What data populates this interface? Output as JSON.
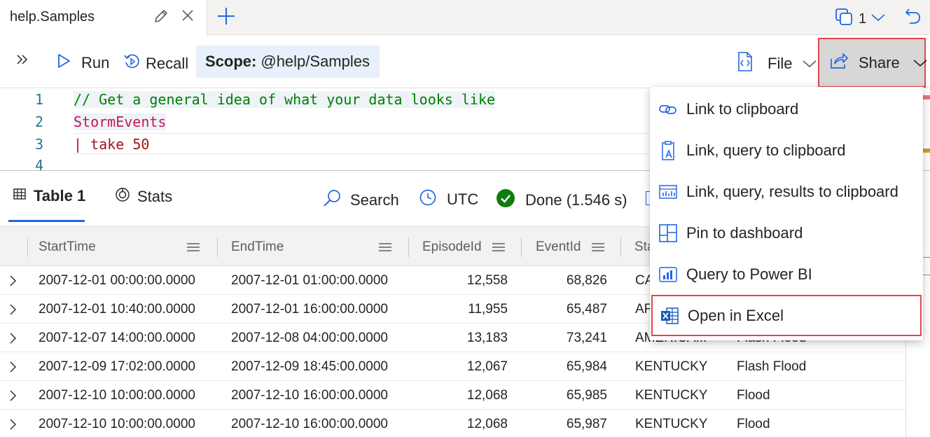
{
  "tab": {
    "title": "help.Samples",
    "copies_count": "1"
  },
  "toolbar": {
    "run_label": "Run",
    "recall_label": "Recall",
    "scope_key": "Scope:",
    "scope_value": "@help/Samples",
    "file_label": "File",
    "share_label": "Share"
  },
  "editor": {
    "lines": [
      {
        "number": "1",
        "text": "// Get a general idea of what your data looks like"
      },
      {
        "number": "2",
        "text": "StormEvents"
      },
      {
        "number": "3",
        "pipe": "| ",
        "keyword": "take",
        "value": "50"
      },
      {
        "number": "4",
        "text": ""
      }
    ]
  },
  "results": {
    "table_tab": "Table 1",
    "stats_tab": "Stats",
    "search_label": "Search",
    "utc_label": "UTC",
    "status": "Done (1.546 s)"
  },
  "grid": {
    "columns": [
      "StartTime",
      "EndTime",
      "EpisodeId",
      "EventId",
      "Sta"
    ],
    "rows": [
      {
        "start": "2007-12-01 00:00:00.0000",
        "end": "2007-12-01 01:00:00.0000",
        "episode": "12,558",
        "event": "68,826",
        "state": "CA",
        "type": ""
      },
      {
        "start": "2007-12-01 10:40:00.0000",
        "end": "2007-12-01 16:00:00.0000",
        "episode": "11,955",
        "event": "65,487",
        "state": "AF",
        "type": ""
      },
      {
        "start": "2007-12-07 14:00:00.0000",
        "end": "2007-12-08 04:00:00.0000",
        "episode": "13,183",
        "event": "73,241",
        "state": "AMERICA...",
        "type": "Flash Flood"
      },
      {
        "start": "2007-12-09 17:02:00.0000",
        "end": "2007-12-09 18:45:00.0000",
        "episode": "12,067",
        "event": "65,984",
        "state": "KENTUCKY",
        "type": "Flash Flood"
      },
      {
        "start": "2007-12-10 10:00:00.0000",
        "end": "2007-12-10 16:00:00.0000",
        "episode": "12,068",
        "event": "65,985",
        "state": "KENTUCKY",
        "type": "Flood"
      },
      {
        "start": "2007-12-10 10:00:00.0000",
        "end": "2007-12-10 16:00:00.0000",
        "episode": "12,068",
        "event": "65,987",
        "state": "KENTUCKY",
        "type": "Flood"
      }
    ]
  },
  "share_menu": {
    "items": [
      {
        "label": "Link to clipboard",
        "icon": "link-icon"
      },
      {
        "label": "Link, query to clipboard",
        "icon": "clipboard-query-icon"
      },
      {
        "label": "Link, query, results to clipboard",
        "icon": "clipboard-results-icon"
      },
      {
        "label": "Pin to dashboard",
        "icon": "dashboard-icon"
      },
      {
        "label": "Query to Power BI",
        "icon": "power-bi-icon"
      },
      {
        "label": "Open in Excel",
        "icon": "excel-icon"
      }
    ]
  },
  "colors": {
    "accent": "#2266e3",
    "highlight_border": "#e0464e",
    "success": "#107c10",
    "excel": "#185abd"
  }
}
